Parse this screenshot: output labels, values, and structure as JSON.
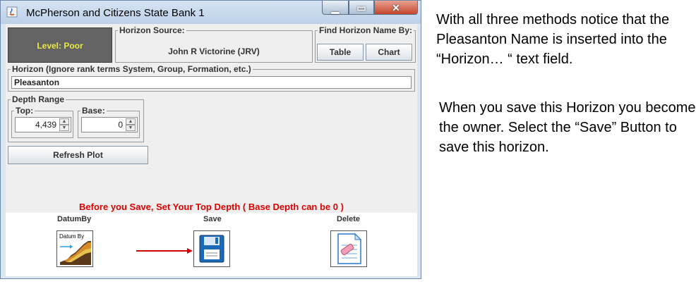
{
  "window": {
    "title": "McPherson and Citizens State Bank 1",
    "controls": [
      "minimize",
      "maximize",
      "close"
    ]
  },
  "level": {
    "label": "Level: Poor"
  },
  "horizon_source": {
    "legend": "Horizon Source:",
    "name": "John R Victorine (JRV)"
  },
  "find_by": {
    "legend": "Find Horizon Name By:",
    "buttons": [
      "Table",
      "Chart"
    ]
  },
  "horizon": {
    "legend": "Horizon (Ignore rank terms System, Group, Formation, etc.)",
    "value": "Pleasanton"
  },
  "depth": {
    "legend": "Depth Range",
    "top": {
      "legend": "Top:",
      "value": "4,439"
    },
    "base": {
      "legend": "Base:",
      "value": "0"
    }
  },
  "refresh": {
    "label": "Refresh Plot"
  },
  "warning": "Before you Save, Set Your Top Depth ( Base Depth can be 0 )",
  "actions": {
    "datum": {
      "label": "DatumBy",
      "icon_text": "Datum By",
      "icon": "datum-by-icon"
    },
    "save": {
      "label": "Save",
      "icon": "floppy-disk-icon"
    },
    "delete": {
      "label": "Delete",
      "icon": "delete-document-icon"
    }
  },
  "notes": {
    "p1": "With all three methods notice that the Pleasanton Name is inserted into the “Horizon… “ text field.",
    "p2": "When you save this Horizon you become the owner.  Select the “Save” Button to save this horizon."
  },
  "colors": {
    "warning": "#e00000",
    "level_text": "#e8e84a",
    "level_bg": "#636363",
    "arrow": "#d40000"
  }
}
